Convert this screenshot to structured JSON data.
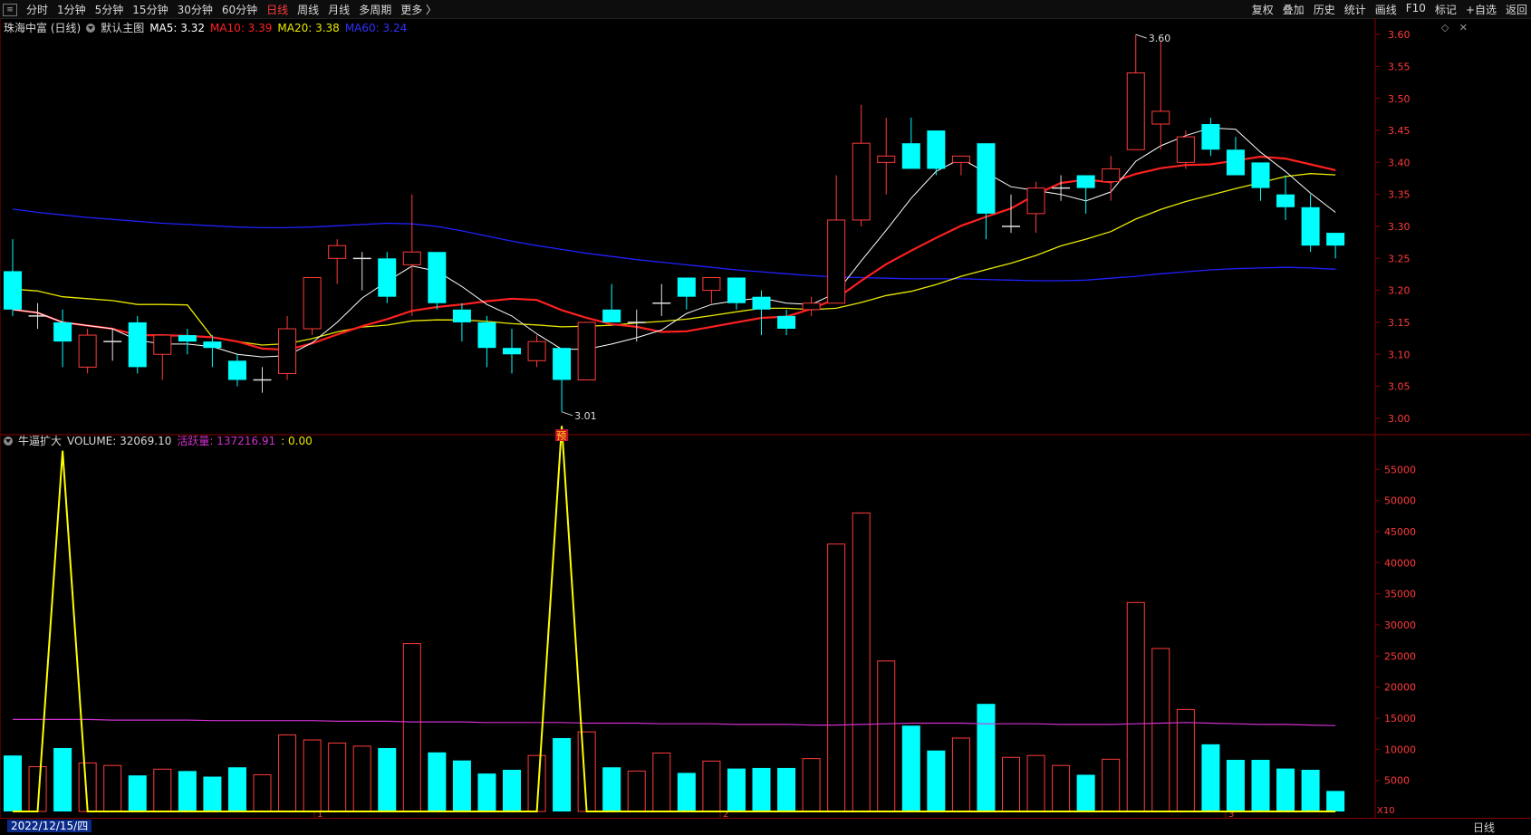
{
  "toolbar": {
    "left_items": [
      "分时",
      "1分钟",
      "5分钟",
      "15分钟",
      "30分钟",
      "60分钟",
      "日线",
      "周线",
      "月线",
      "多周期",
      "更多 〉"
    ],
    "active_index": 6,
    "right_items": [
      "复权",
      "叠加",
      "历史",
      "统计",
      "画线",
      "F10",
      "标记",
      "+自选",
      "返回"
    ]
  },
  "price_legend": {
    "stock": "珠海中富 (日线)",
    "template": "默认主图",
    "ma5": "MA5: 3.32",
    "ma10": "MA10: 3.39",
    "ma20": "MA20: 3.38",
    "ma60": "MA60: 3.24"
  },
  "volume_legend": {
    "indicator": "牛逼扩大",
    "volume": "VOLUME: 32069.10",
    "active_label": "活跃量",
    "active_value": ": 137216.91",
    "extra": ": 0.00"
  },
  "colors": {
    "up": "#ff3b3b",
    "down": "#00ffff",
    "ma5": "#ffffff",
    "ma10": "#ff2020",
    "ma20": "#e8e800",
    "ma60": "#2020ff",
    "active": "#d030d0",
    "signal": "#ffff00",
    "grid": "#8b0000"
  },
  "chart_data": {
    "type": "candlestick",
    "price_axis": {
      "ylim": [
        2.98,
        3.62
      ],
      "ticks": [
        "3.00",
        "3.05",
        "3.10",
        "3.15",
        "3.20",
        "3.25",
        "3.30",
        "3.35",
        "3.40",
        "3.45",
        "3.50",
        "3.55",
        "3.60"
      ]
    },
    "volume_axis": {
      "ylim": [
        0,
        60000
      ],
      "ticks": [
        "5000",
        "10000",
        "15000",
        "20000",
        "25000",
        "30000",
        "35000",
        "40000",
        "45000",
        "50000",
        "55000"
      ],
      "unit": "X10"
    },
    "annotations": {
      "high": "3.60",
      "low": "3.01",
      "marker": "预"
    },
    "x_labels": [
      "2022/12/15/四",
      "1",
      "2",
      "3"
    ],
    "period": "日线",
    "candles": [
      {
        "o": 3.23,
        "c": 3.17,
        "h": 3.28,
        "l": 3.16
      },
      {
        "o": 3.16,
        "c": 3.16,
        "h": 3.18,
        "l": 3.14
      },
      {
        "o": 3.15,
        "c": 3.12,
        "h": 3.17,
        "l": 3.08
      },
      {
        "o": 3.08,
        "c": 3.13,
        "h": 3.14,
        "l": 3.07
      },
      {
        "o": 3.12,
        "c": 3.12,
        "h": 3.14,
        "l": 3.09
      },
      {
        "o": 3.15,
        "c": 3.08,
        "h": 3.16,
        "l": 3.07
      },
      {
        "o": 3.1,
        "c": 3.13,
        "h": 3.13,
        "l": 3.06
      },
      {
        "o": 3.13,
        "c": 3.12,
        "h": 3.14,
        "l": 3.1
      },
      {
        "o": 3.12,
        "c": 3.11,
        "h": 3.13,
        "l": 3.08
      },
      {
        "o": 3.09,
        "c": 3.06,
        "h": 3.1,
        "l": 3.05
      },
      {
        "o": 3.06,
        "c": 3.06,
        "h": 3.08,
        "l": 3.04
      },
      {
        "o": 3.07,
        "c": 3.14,
        "h": 3.16,
        "l": 3.06
      },
      {
        "o": 3.14,
        "c": 3.22,
        "h": 3.22,
        "l": 3.13
      },
      {
        "o": 3.25,
        "c": 3.27,
        "h": 3.28,
        "l": 3.21
      },
      {
        "o": 3.25,
        "c": 3.25,
        "h": 3.26,
        "l": 3.2
      },
      {
        "o": 3.25,
        "c": 3.19,
        "h": 3.26,
        "l": 3.18
      },
      {
        "o": 3.24,
        "c": 3.26,
        "h": 3.35,
        "l": 3.16
      },
      {
        "o": 3.26,
        "c": 3.18,
        "h": 3.26,
        "l": 3.17
      },
      {
        "o": 3.17,
        "c": 3.15,
        "h": 3.18,
        "l": 3.12
      },
      {
        "o": 3.15,
        "c": 3.11,
        "h": 3.16,
        "l": 3.08
      },
      {
        "o": 3.11,
        "c": 3.1,
        "h": 3.14,
        "l": 3.07
      },
      {
        "o": 3.09,
        "c": 3.12,
        "h": 3.13,
        "l": 3.08
      },
      {
        "o": 3.11,
        "c": 3.06,
        "h": 3.11,
        "l": 3.01
      },
      {
        "o": 3.06,
        "c": 3.15,
        "h": 3.15,
        "l": 3.06
      },
      {
        "o": 3.17,
        "c": 3.15,
        "h": 3.21,
        "l": 3.15
      },
      {
        "o": 3.15,
        "c": 3.15,
        "h": 3.17,
        "l": 3.12
      },
      {
        "o": 3.18,
        "c": 3.18,
        "h": 3.21,
        "l": 3.16
      },
      {
        "o": 3.22,
        "c": 3.19,
        "h": 3.22,
        "l": 3.17
      },
      {
        "o": 3.2,
        "c": 3.22,
        "h": 3.22,
        "l": 3.18
      },
      {
        "o": 3.22,
        "c": 3.18,
        "h": 3.22,
        "l": 3.17
      },
      {
        "o": 3.19,
        "c": 3.17,
        "h": 3.2,
        "l": 3.13
      },
      {
        "o": 3.16,
        "c": 3.14,
        "h": 3.17,
        "l": 3.13
      },
      {
        "o": 3.17,
        "c": 3.18,
        "h": 3.19,
        "l": 3.16
      },
      {
        "o": 3.18,
        "c": 3.31,
        "h": 3.38,
        "l": 3.18
      },
      {
        "o": 3.31,
        "c": 3.43,
        "h": 3.49,
        "l": 3.3
      },
      {
        "o": 3.4,
        "c": 3.41,
        "h": 3.47,
        "l": 3.35
      },
      {
        "o": 3.43,
        "c": 3.39,
        "h": 3.47,
        "l": 3.39
      },
      {
        "o": 3.45,
        "c": 3.39,
        "h": 3.45,
        "l": 3.38
      },
      {
        "o": 3.4,
        "c": 3.41,
        "h": 3.41,
        "l": 3.38
      },
      {
        "o": 3.43,
        "c": 3.32,
        "h": 3.43,
        "l": 3.28
      },
      {
        "o": 3.3,
        "c": 3.3,
        "h": 3.35,
        "l": 3.29
      },
      {
        "o": 3.32,
        "c": 3.36,
        "h": 3.37,
        "l": 3.29
      },
      {
        "o": 3.36,
        "c": 3.36,
        "h": 3.38,
        "l": 3.34
      },
      {
        "o": 3.38,
        "c": 3.36,
        "h": 3.38,
        "l": 3.32
      },
      {
        "o": 3.37,
        "c": 3.39,
        "h": 3.41,
        "l": 3.34
      },
      {
        "o": 3.42,
        "c": 3.54,
        "h": 3.6,
        "l": 3.42
      },
      {
        "o": 3.46,
        "c": 3.48,
        "h": 3.59,
        "l": 3.42
      },
      {
        "o": 3.4,
        "c": 3.44,
        "h": 3.45,
        "l": 3.39
      },
      {
        "o": 3.46,
        "c": 3.42,
        "h": 3.47,
        "l": 3.41
      },
      {
        "o": 3.42,
        "c": 3.38,
        "h": 3.44,
        "l": 3.38
      },
      {
        "o": 3.4,
        "c": 3.36,
        "h": 3.4,
        "l": 3.34
      },
      {
        "o": 3.35,
        "c": 3.33,
        "h": 3.38,
        "l": 3.31
      },
      {
        "o": 3.33,
        "c": 3.27,
        "h": 3.35,
        "l": 3.26
      },
      {
        "o": 3.29,
        "c": 3.27,
        "h": 3.29,
        "l": 3.25
      }
    ],
    "volumes": [
      9000,
      7200,
      10200,
      7800,
      7400,
      5800,
      6800,
      6500,
      5600,
      7100,
      5900,
      12300,
      11500,
      11000,
      10500,
      10200,
      27000,
      9500,
      8200,
      6100,
      6700,
      9000,
      11800,
      12800,
      7100,
      6500,
      9400,
      6200,
      8100,
      6900,
      7000,
      7000,
      8500,
      43000,
      48000,
      24200,
      13800,
      9800,
      11800,
      17300,
      8700,
      9000,
      7400,
      5900,
      8400,
      33600,
      26200,
      16400,
      10800,
      8300,
      8300,
      6900,
      6700,
      3300
    ],
    "active_volume": [
      14800,
      14800,
      14800,
      14800,
      14700,
      14700,
      14700,
      14700,
      14600,
      14600,
      14600,
      14600,
      14600,
      14500,
      14500,
      14500,
      14400,
      14400,
      14400,
      14300,
      14300,
      14300,
      14300,
      14200,
      14200,
      14200,
      14100,
      14100,
      14100,
      14000,
      14000,
      14000,
      13900,
      13900,
      14000,
      14100,
      14200,
      14200,
      14200,
      14100,
      14100,
      14100,
      14000,
      14000,
      14000,
      14100,
      14200,
      14300,
      14200,
      14100,
      14000,
      14000,
      13900,
      13800
    ],
    "signal": [
      0,
      0,
      58000,
      0,
      0,
      0,
      0,
      0,
      0,
      0,
      0,
      0,
      0,
      0,
      0,
      0,
      0,
      0,
      0,
      0,
      0,
      0,
      62000,
      0,
      0,
      0,
      0,
      0,
      0,
      0,
      0,
      0,
      0,
      0,
      0,
      0,
      0,
      0,
      0,
      0,
      0,
      0,
      0,
      0,
      0,
      0,
      0,
      0,
      0,
      0,
      0,
      0,
      0,
      0
    ],
    "ma60": [
      3.327,
      3.322,
      3.318,
      3.314,
      3.311,
      3.308,
      3.305,
      3.303,
      3.301,
      3.299,
      3.298,
      3.298,
      3.299,
      3.301,
      3.303,
      3.305,
      3.304,
      3.3,
      3.293,
      3.285,
      3.277,
      3.27,
      3.264,
      3.258,
      3.253,
      3.248,
      3.244,
      3.24,
      3.236,
      3.232,
      3.229,
      3.226,
      3.223,
      3.221,
      3.22,
      3.219,
      3.218,
      3.218,
      3.218,
      3.217,
      3.216,
      3.215,
      3.215,
      3.216,
      3.219,
      3.222,
      3.226,
      3.229,
      3.232,
      3.234,
      3.235,
      3.236,
      3.235,
      3.233
    ]
  }
}
